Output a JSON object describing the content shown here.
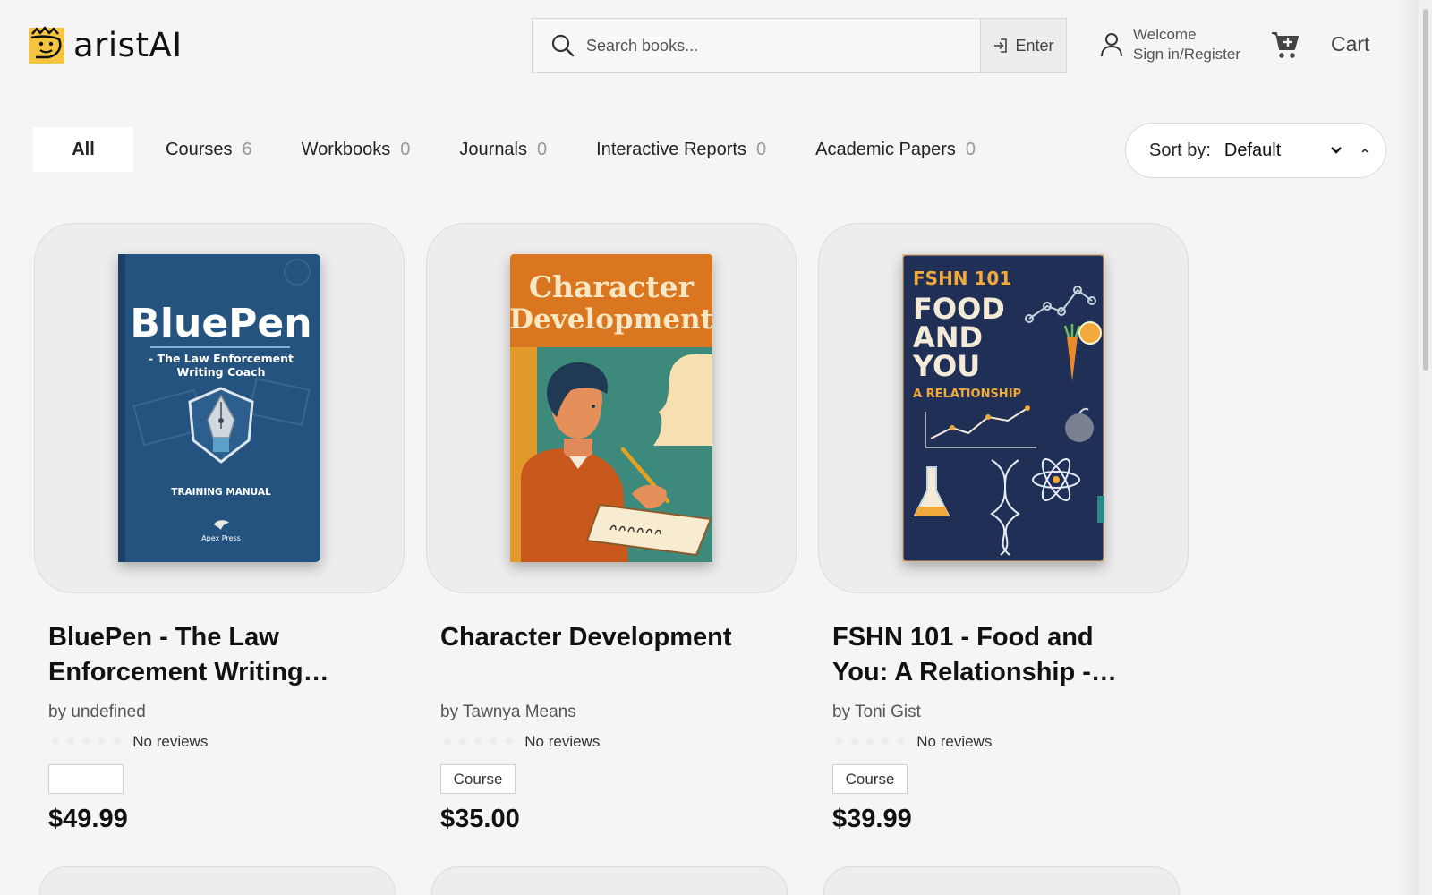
{
  "header": {
    "brand": "aristAI",
    "search_placeholder": "Search books...",
    "enter_label": "Enter",
    "account_line1": "Welcome",
    "account_line2": "Sign in/Register",
    "cart_label": "Cart"
  },
  "filters": [
    {
      "label": "All",
      "count": null,
      "active": true
    },
    {
      "label": "Courses",
      "count": "6"
    },
    {
      "label": "Workbooks",
      "count": "0"
    },
    {
      "label": "Journals",
      "count": "0"
    },
    {
      "label": "Interactive Reports",
      "count": "0"
    },
    {
      "label": "Academic Papers",
      "count": "0"
    }
  ],
  "sort": {
    "label": "Sort by:",
    "value": "Default"
  },
  "products": [
    {
      "title": "BluePen - The Law Enforcement Writing…",
      "author": "by undefined",
      "reviews": "No reviews",
      "badge": "",
      "price": "$49.99",
      "cover": {
        "title": "BluePen",
        "subtitle_1": "- The Law Enforcement",
        "subtitle_2": "Writing Coach",
        "footer": "TRAINING MANUAL",
        "publisher": "Apex Press",
        "color": "#24537f"
      }
    },
    {
      "title": "Character Development",
      "author": "by Tawnya Means",
      "reviews": "No reviews",
      "badge": "Course",
      "price": "$35.00",
      "cover": {
        "title_1": "Character",
        "title_2": "Development",
        "color": "#d9761f"
      }
    },
    {
      "title": "FSHN 101 - Food and You: A Relationship -…",
      "author": "by Toni Gist",
      "reviews": "No reviews",
      "badge": "Course",
      "price": "$39.99",
      "cover": {
        "line_1": "FSHN 101",
        "line_2": "FOOD",
        "line_3": "AND",
        "line_4": "YOU",
        "line_5": "A RELATIONSHIP",
        "color": "#1f2f55"
      }
    }
  ],
  "colors": {
    "accent": "#f5c542",
    "background": "#f5f5f5",
    "card": "#ededed"
  }
}
